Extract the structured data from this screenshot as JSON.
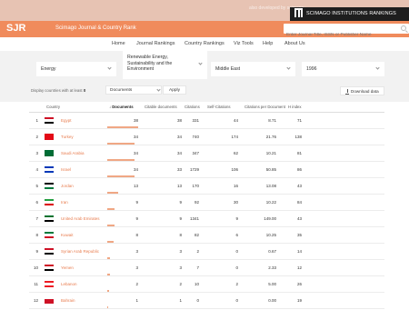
{
  "topbar": {
    "developed_by": "also developed by scimago:",
    "institutions_label": "SCIMAGO INSTITUTIONS RANKINGS"
  },
  "header": {
    "brand": "SJR",
    "brand_name": "Scimago Journal & Country Rank",
    "search_placeholder": "Enter Journal Title, ISSN or Publisher Name"
  },
  "nav": {
    "items": [
      "Home",
      "Journal Rankings",
      "Country Rankings",
      "Viz Tools",
      "Help",
      "About Us"
    ]
  },
  "filters": {
    "subject_area": "Energy",
    "subject_category": "Renewable Energy, Sustainability and the Environment",
    "region": "Middle East",
    "year": "1996"
  },
  "controls": {
    "show_label": "Display countries with at least",
    "min_value": "0",
    "metric": "Documents",
    "apply_label": "Apply",
    "download_label": "Download data"
  },
  "table": {
    "headers": {
      "country": "Country",
      "documents": "Documents",
      "citable": "Citable documents",
      "citations": "Citations",
      "self_citations": "Self-Citations",
      "cpd": "Citations per Document",
      "h_index": "H index"
    },
    "sort_arrow": "↓",
    "rows": [
      {
        "rank": "1",
        "country": "Egypt",
        "documents": "38",
        "citable": "38",
        "citations": "331",
        "self": "44",
        "cpd": "8.71",
        "h": "71",
        "share": 1.0,
        "flag": [
          "#ce1126",
          "#ffffff",
          "#000000"
        ]
      },
      {
        "rank": "2",
        "country": "Turkey",
        "documents": "34",
        "citable": "34",
        "citations": "740",
        "self": "174",
        "cpd": "21.76",
        "h": "138",
        "share": 0.895,
        "flag": [
          "#e30a17",
          "#e30a17",
          "#e30a17"
        ]
      },
      {
        "rank": "3",
        "country": "Saudi Arabia",
        "documents": "34",
        "citable": "34",
        "citations": "347",
        "self": "62",
        "cpd": "10.21",
        "h": "81",
        "share": 0.895,
        "flag": [
          "#006c35",
          "#006c35",
          "#006c35"
        ]
      },
      {
        "rank": "4",
        "country": "Israel",
        "documents": "34",
        "citable": "33",
        "citations": "1729",
        "self": "106",
        "cpd": "50.85",
        "h": "86",
        "share": 0.895,
        "flag": [
          "#0038b8",
          "#ffffff",
          "#0038b8"
        ]
      },
      {
        "rank": "5",
        "country": "Jordan",
        "documents": "13",
        "citable": "13",
        "citations": "170",
        "self": "16",
        "cpd": "13.08",
        "h": "43",
        "share": 0.342,
        "flag": [
          "#000000",
          "#ffffff",
          "#007a3d"
        ]
      },
      {
        "rank": "6",
        "country": "Iran",
        "documents": "9",
        "citable": "9",
        "citations": "92",
        "self": "30",
        "cpd": "10.22",
        "h": "84",
        "share": 0.237,
        "flag": [
          "#239f40",
          "#ffffff",
          "#da0000"
        ]
      },
      {
        "rank": "7",
        "country": "United Arab Emirates",
        "documents": "9",
        "citable": "9",
        "citations": "1341",
        "self": "9",
        "cpd": "149.00",
        "h": "43",
        "share": 0.237,
        "flag": [
          "#00732f",
          "#ffffff",
          "#000000"
        ]
      },
      {
        "rank": "8",
        "country": "Kuwait",
        "documents": "8",
        "citable": "8",
        "citations": "82",
        "self": "6",
        "cpd": "10.25",
        "h": "35",
        "share": 0.21,
        "flag": [
          "#007a3d",
          "#ffffff",
          "#ce1126"
        ]
      },
      {
        "rank": "9",
        "country": "Syrian Arab Republic",
        "documents": "3",
        "citable": "3",
        "citations": "2",
        "self": "0",
        "cpd": "0.67",
        "h": "14",
        "share": 0.079,
        "flag": [
          "#ce1126",
          "#ffffff",
          "#000000"
        ]
      },
      {
        "rank": "10",
        "country": "Yemen",
        "documents": "3",
        "citable": "3",
        "citations": "7",
        "self": "0",
        "cpd": "2.33",
        "h": "12",
        "share": 0.079,
        "flag": [
          "#ce1126",
          "#ffffff",
          "#000000"
        ]
      },
      {
        "rank": "11",
        "country": "Lebanon",
        "documents": "2",
        "citable": "2",
        "citations": "10",
        "self": "2",
        "cpd": "5.00",
        "h": "26",
        "share": 0.053,
        "flag": [
          "#ed1c24",
          "#ffffff",
          "#ed1c24"
        ]
      },
      {
        "rank": "12",
        "country": "Bahrain",
        "documents": "1",
        "citable": "1",
        "citations": "0",
        "self": "0",
        "cpd": "0.00",
        "h": "19",
        "share": 0.026,
        "flag": [
          "#ffffff",
          "#ce1126",
          "#ce1126"
        ]
      }
    ]
  }
}
